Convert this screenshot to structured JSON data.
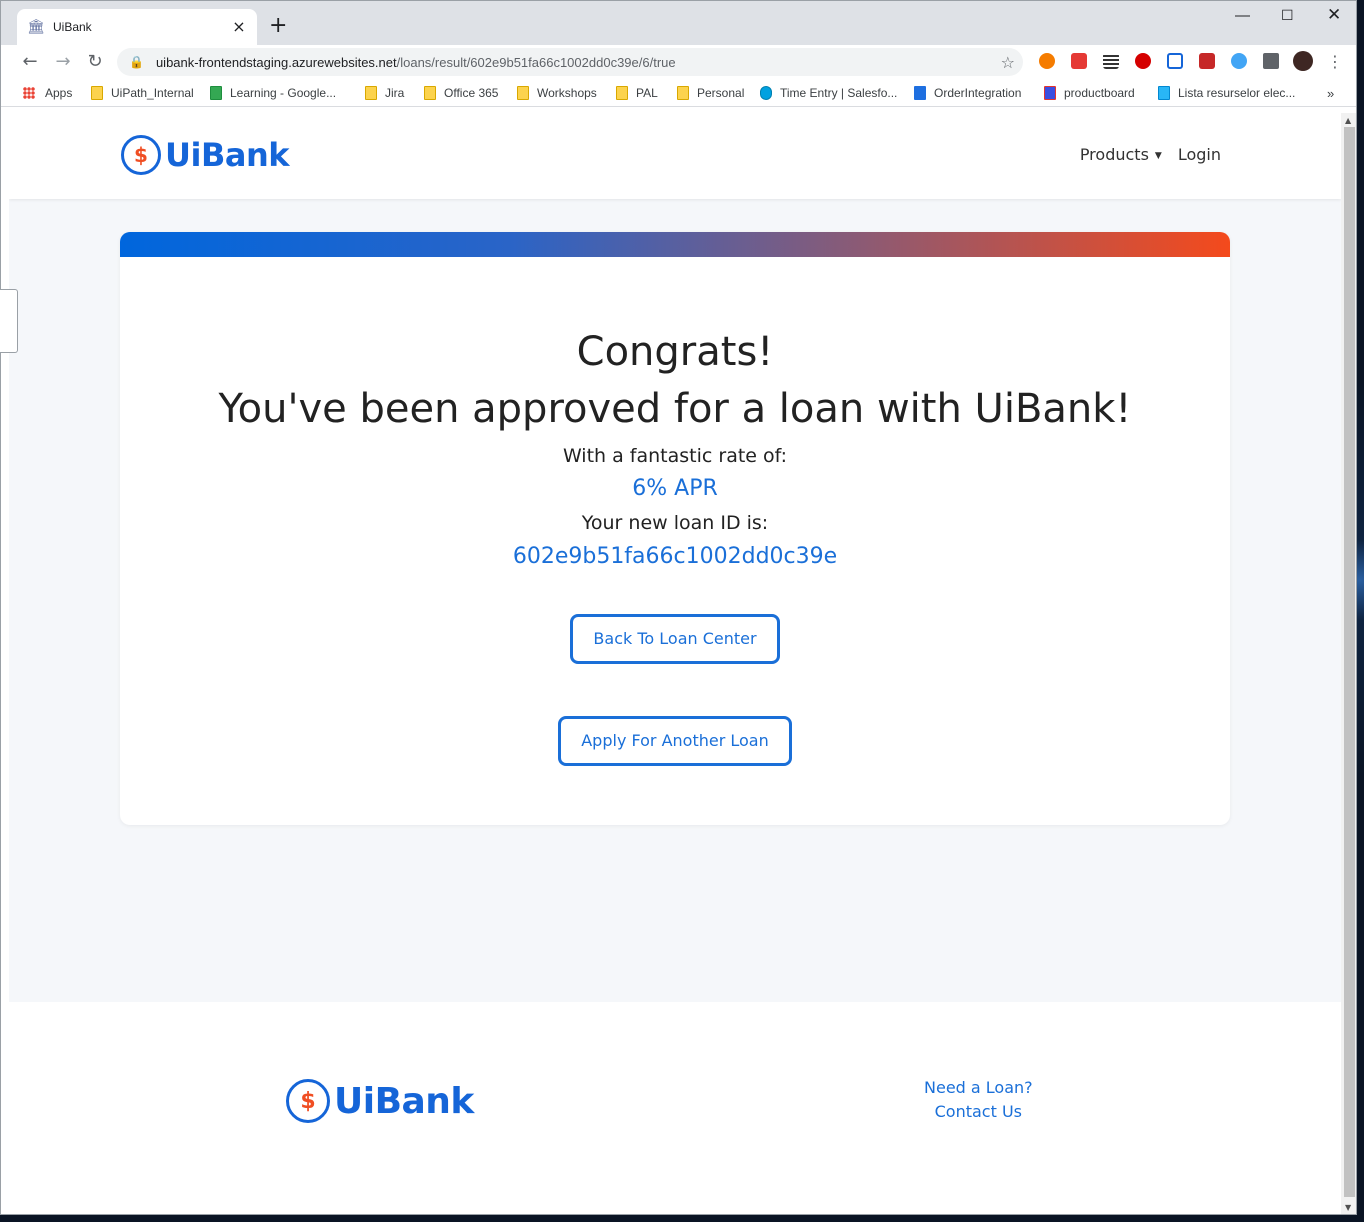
{
  "browser": {
    "tab_title": "UiBank",
    "url_host": "uibank-frontendstaging.azurewebsites.net",
    "url_path": "/loans/result/602e9b51fa66c1002dd0c39e/6/true",
    "bookmarks": [
      "Apps",
      "UiPath_Internal",
      "Learning - Google...",
      "Jira",
      "Office 365",
      "Workshops",
      "PAL",
      "Personal",
      "Time Entry | Salesfo...",
      "OrderIntegration",
      "productboard",
      "Lista resurselor elec..."
    ]
  },
  "header": {
    "logo_text": "UiBank",
    "nav_products": "Products",
    "nav_login": "Login"
  },
  "result": {
    "congrats": "Congrats!",
    "approved": "You've been approved for a loan with UiBank!",
    "rate_label": "With a fantastic rate of:",
    "rate_value": "6% APR",
    "loan_label": "Your new loan ID is:",
    "loan_id": "602e9b51fa66c1002dd0c39e",
    "back_button": "Back To Loan Center",
    "apply_button": "Apply For Another Loan"
  },
  "footer": {
    "logo_text": "UiBank",
    "need_loan": "Need a Loan?",
    "contact": "Contact Us"
  },
  "colors": {
    "brand_blue": "#1565d8",
    "brand_orange": "#f04e23",
    "link_blue": "#1a6fd8"
  }
}
